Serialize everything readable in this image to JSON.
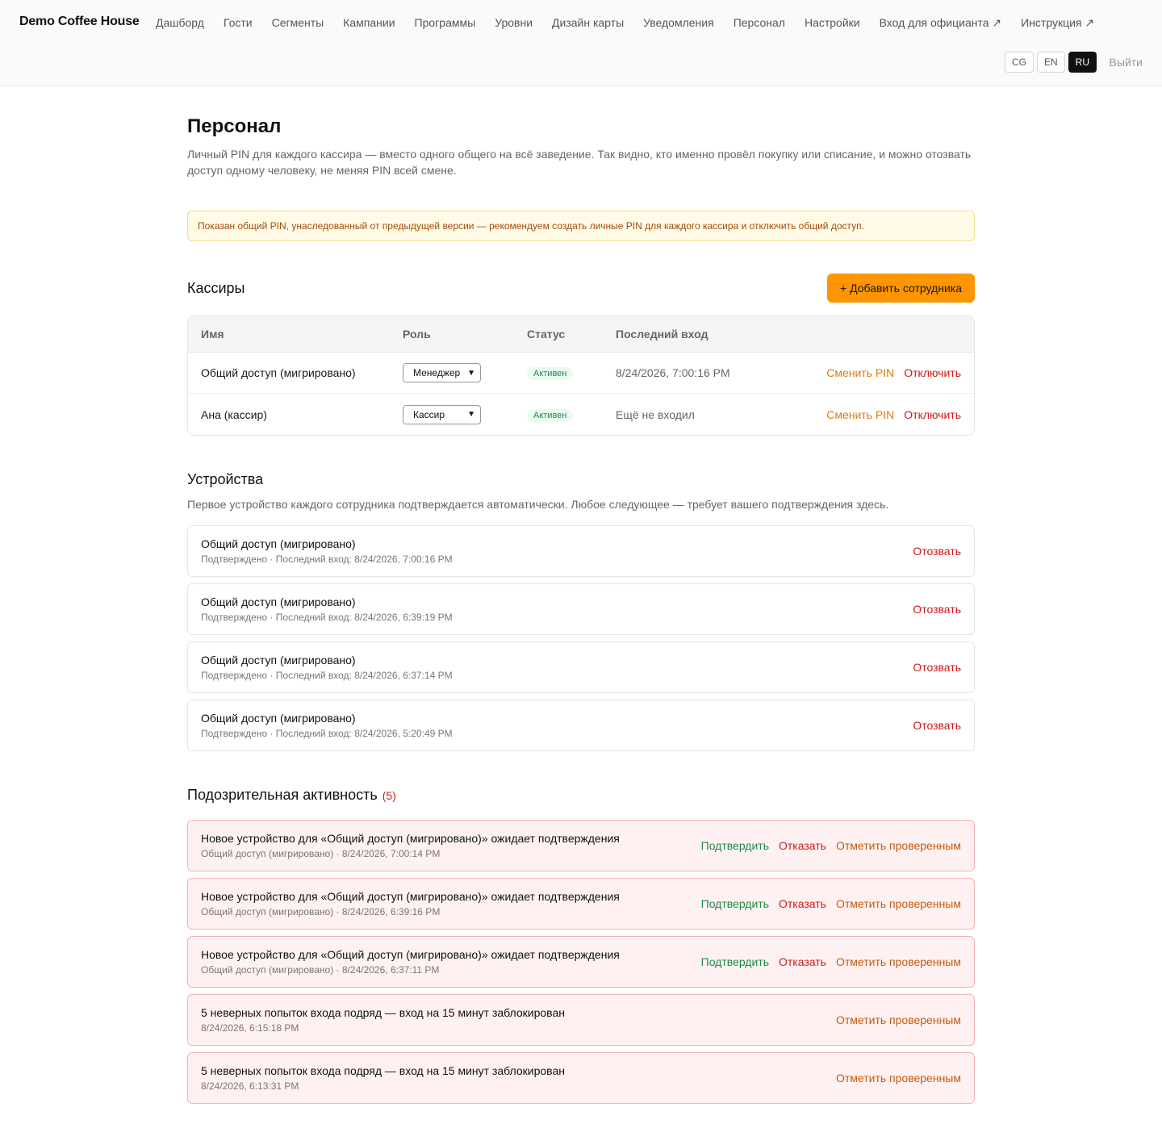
{
  "header": {
    "brand": "Demo Coffee House",
    "nav": [
      "Дашборд",
      "Гости",
      "Сегменты",
      "Кампании",
      "Программы",
      "Уровни",
      "Дизайн карты",
      "Уведомления",
      "Персонал",
      "Настройки",
      "Вход для официанта ↗",
      "Инструкция ↗"
    ],
    "languages": [
      "CG",
      "EN",
      "RU"
    ],
    "active_language": "RU",
    "logout": "Выйти"
  },
  "page": {
    "title": "Персонал",
    "lead": "Личный PIN для каждого кассира — вместо одного общего на всё заведение. Так видно, кто именно провёл покупку или списание, и можно отозвать доступ одному человеку, не меняя PIN всей смене.",
    "notice": "Показан общий PIN, унаследованный от предыдущей версии — рекомендуем создать личные PIN для каждого кассира и отключить общий доступ."
  },
  "cashiers": {
    "title": "Кассиры",
    "add_button": "+ Добавить сотрудника",
    "columns": [
      "Имя",
      "Роль",
      "Статус",
      "Последний вход"
    ],
    "rows": [
      {
        "name": "Общий доступ (мигрировано)",
        "role": "Менеджер",
        "status": "Активен",
        "last": "8/24/2026, 7:00:16 PM",
        "change_pin": "Сменить PIN",
        "disable": "Отключить"
      },
      {
        "name": "Ана (кассир)",
        "role": "Кассир",
        "status": "Активен",
        "last": "Ещё не входил",
        "change_pin": "Сменить PIN",
        "disable": "Отключить"
      }
    ]
  },
  "devices": {
    "title": "Устройства",
    "description": "Первое устройство каждого сотрудника подтверждается автоматически. Любое следующее — требует вашего подтверждения здесь.",
    "items": [
      {
        "name": "Общий доступ (мигрировано)",
        "meta": "Подтверждено · Последний вход: 8/24/2026, 7:00:16 PM",
        "action": "Отозвать"
      },
      {
        "name": "Общий доступ (мигрировано)",
        "meta": "Подтверждено · Последний вход: 8/24/2026, 6:39:19 PM",
        "action": "Отозвать"
      },
      {
        "name": "Общий доступ (мигрировано)",
        "meta": "Подтверждено · Последний вход: 8/24/2026, 6:37:14 PM",
        "action": "Отозвать"
      },
      {
        "name": "Общий доступ (мигрировано)",
        "meta": "Подтверждено · Последний вход: 8/24/2026, 5:20:49 PM",
        "action": "Отозвать"
      }
    ]
  },
  "suspicious": {
    "title": "Подозрительная активность",
    "count": "(5)",
    "items": [
      {
        "title": "Новое устройство для «Общий доступ (мигрировано)» ожидает подтверждения",
        "meta": "Общий доступ (мигрировано) · 8/24/2026, 7:00:14 PM",
        "approve": "Подтвердить",
        "reject": "Отказать",
        "mark": "Отметить проверенным"
      },
      {
        "title": "Новое устройство для «Общий доступ (мигрировано)» ожидает подтверждения",
        "meta": "Общий доступ (мигрировано) · 8/24/2026, 6:39:16 PM",
        "approve": "Подтвердить",
        "reject": "Отказать",
        "mark": "Отметить проверенным"
      },
      {
        "title": "Новое устройство для «Общий доступ (мигрировано)» ожидает подтверждения",
        "meta": "Общий доступ (мигрировано) · 8/24/2026, 6:37:11 PM",
        "approve": "Подтвердить",
        "reject": "Отказать",
        "mark": "Отметить проверенным"
      },
      {
        "title": "5 неверных попыток входа подряд — вход на 15 минут заблокирован",
        "meta": "8/24/2026, 6:15:18 PM",
        "mark": "Отметить проверенным"
      },
      {
        "title": "5 неверных попыток входа подряд — вход на 15 минут заблокирован",
        "meta": "8/24/2026, 6:13:31 PM",
        "mark": "Отметить проверенным"
      }
    ]
  },
  "colors": {
    "accent": "#ff9500",
    "danger": "#d21818",
    "success": "#1b8a4a"
  }
}
